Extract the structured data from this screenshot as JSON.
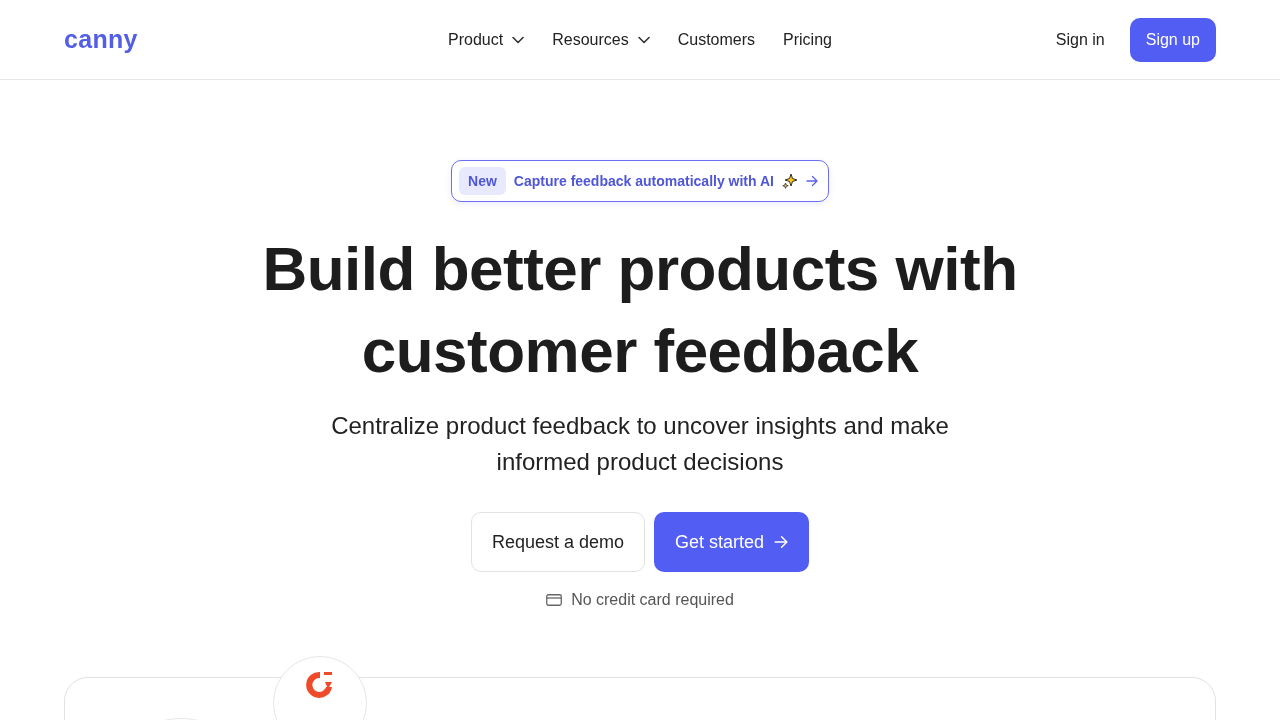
{
  "header": {
    "logo": "canny",
    "nav": [
      {
        "label": "Product",
        "dropdown": true
      },
      {
        "label": "Resources",
        "dropdown": true
      },
      {
        "label": "Customers",
        "dropdown": false
      },
      {
        "label": "Pricing",
        "dropdown": false
      }
    ],
    "sign_in": "Sign in",
    "sign_up": "Sign up"
  },
  "hero": {
    "announcement": {
      "badge": "New",
      "text": "Capture feedback automatically with AI"
    },
    "title_lines": [
      "Build better products with",
      "customer feedback"
    ],
    "subtitle": "Centralize product feedback to uncover insights and make informed product decisions",
    "secondary_button": "Request a demo",
    "primary_button": "Get started",
    "note": "No credit card required"
  }
}
